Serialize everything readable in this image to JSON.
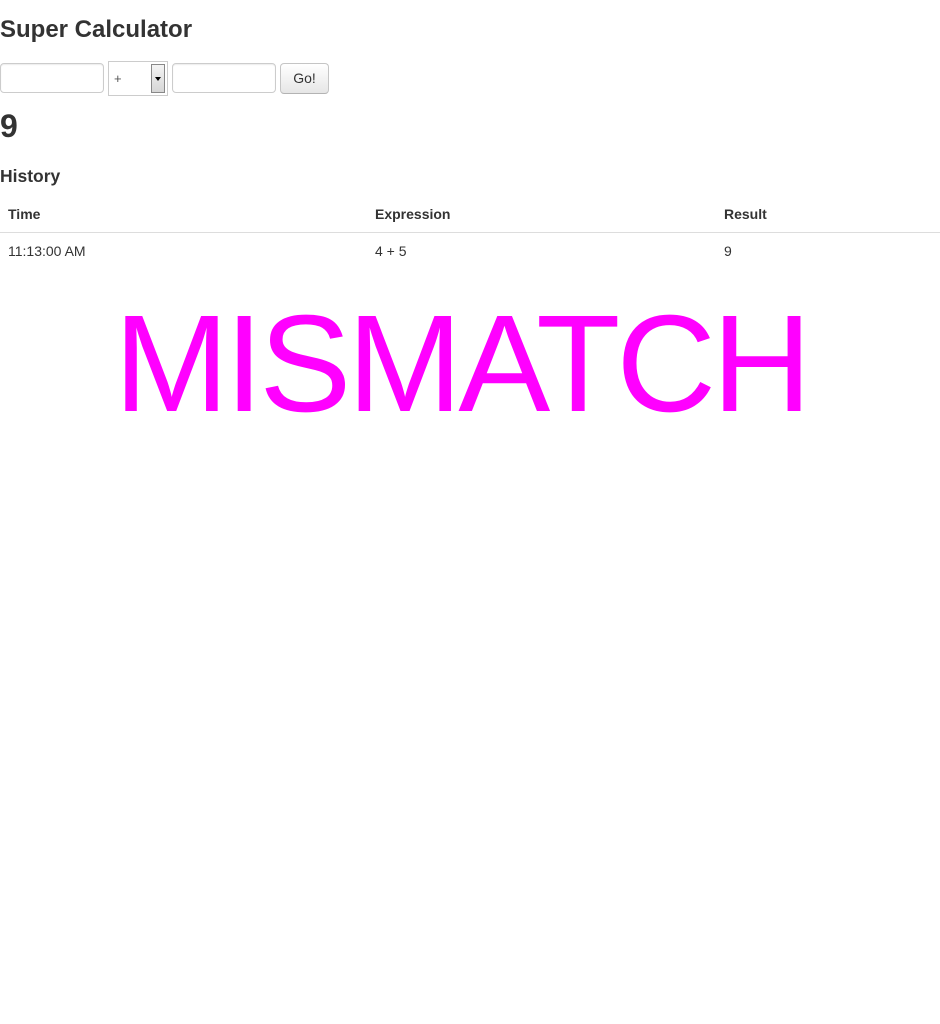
{
  "app": {
    "title": "Super Calculator"
  },
  "form": {
    "first_value": "",
    "operator": "+",
    "second_value": "",
    "go_label": "Go!"
  },
  "result": {
    "value": "9"
  },
  "history": {
    "heading": "History",
    "columns": [
      "Time",
      "Expression",
      "Result"
    ],
    "rows": [
      {
        "time": "11:13:00 AM",
        "expression": "4 + 5",
        "result": "9"
      }
    ]
  },
  "overlay": {
    "text": "MISMATCH",
    "color": "#ff00ff"
  },
  "colors": {
    "text": "#333333",
    "overlay": "#ff00ff",
    "border": "#cccccc"
  }
}
